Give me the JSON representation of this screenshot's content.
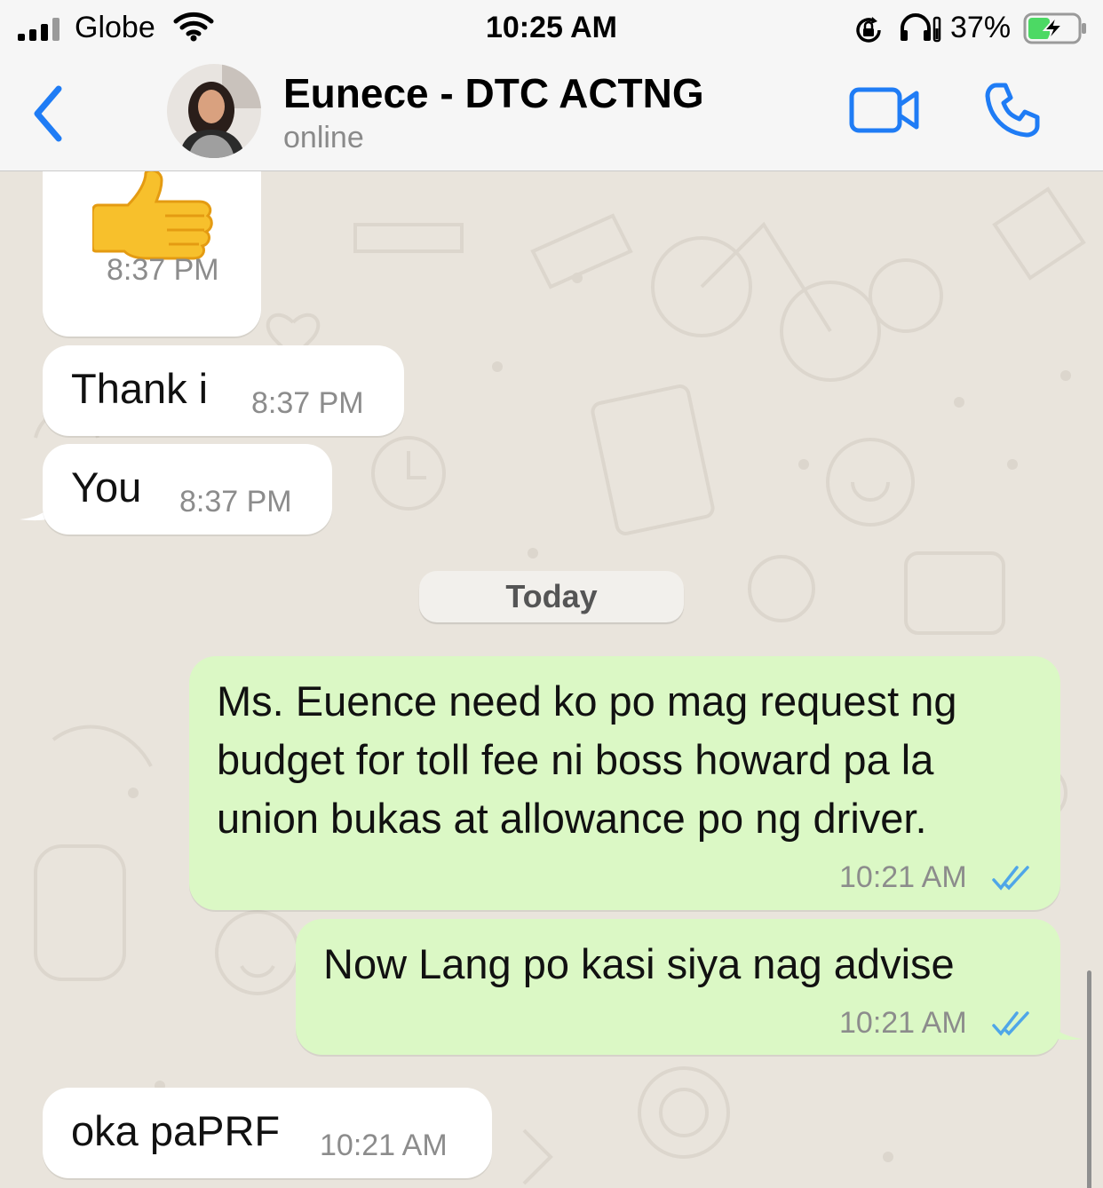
{
  "status_bar": {
    "carrier": "Globe",
    "time": "10:25 AM",
    "battery_percent": "37%",
    "icons": [
      "signal-icon",
      "wifi-icon",
      "rotation-lock-icon",
      "headphones-icon",
      "battery-charging-icon"
    ]
  },
  "header": {
    "contact_name": "Eunece - DTC ACTNG",
    "status": "online",
    "icons": [
      "back-chevron-icon",
      "video-camera-icon",
      "phone-icon"
    ],
    "accent_color": "#1f7cf5"
  },
  "chat": {
    "day_divider": "Today",
    "messages": [
      {
        "direction": "in",
        "content": "thumbs-up-emoji",
        "time": "8:37 PM"
      },
      {
        "direction": "in",
        "text": "Thank i",
        "time": "8:37 PM"
      },
      {
        "direction": "in",
        "text": "You",
        "time": "8:37 PM"
      },
      {
        "direction": "out",
        "lines": [
          "Ms. Euence need ko po mag request ng",
          "budget for toll fee ni boss howard pa la",
          "union bukas at allowance po ng driver."
        ],
        "time": "10:21 AM",
        "read": true
      },
      {
        "direction": "out",
        "text": "Now Lang po kasi siya nag advise",
        "time": "10:21 AM",
        "read": true
      },
      {
        "direction": "in",
        "text": "oka paPRF",
        "time": "10:21 AM"
      }
    ],
    "colors": {
      "incoming_bubble": "#ffffff",
      "outgoing_bubble": "#dbf8c5",
      "read_ticks": "#4fa6e8",
      "wallpaper": "#e9e4dc"
    }
  }
}
